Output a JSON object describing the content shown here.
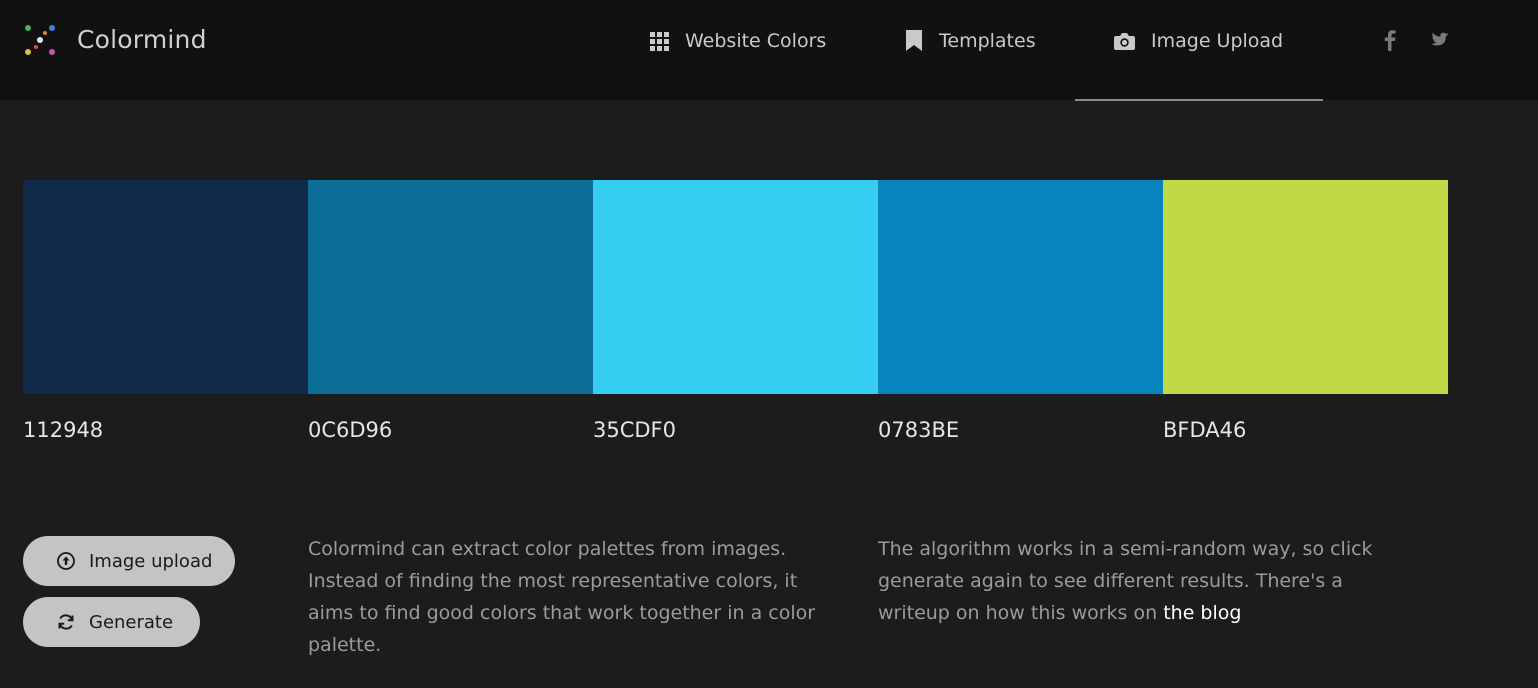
{
  "app": {
    "brand": "Colormind"
  },
  "nav": {
    "website_colors": "Website Colors",
    "templates": "Templates",
    "image_upload": "Image Upload",
    "active": "Image Upload"
  },
  "social": {
    "facebook_icon": "facebook-icon",
    "twitter_icon": "twitter-icon"
  },
  "palette": [
    {
      "hex": "112948",
      "color": "#112948"
    },
    {
      "hex": "0C6D96",
      "color": "#0C6D96"
    },
    {
      "hex": "35CDF0",
      "color": "#35CDF0"
    },
    {
      "hex": "0783BE",
      "color": "#0783BE"
    },
    {
      "hex": "BFDA46",
      "color": "#BFDA46"
    }
  ],
  "buttons": {
    "image_upload": "Image upload",
    "generate": "Generate"
  },
  "description": {
    "left": "Colormind can extract color palettes from images. Instead of finding the most representative colors, it aims to find good colors that work together in a color palette.",
    "right_text": "The algorithm works in a semi-random way, so click generate again to see different results. There's a writeup on how this works on ",
    "right_link": "the blog"
  },
  "colors": {
    "background": "#1c1c1c",
    "topbar": "#111111",
    "button": "#c4c4c4"
  }
}
